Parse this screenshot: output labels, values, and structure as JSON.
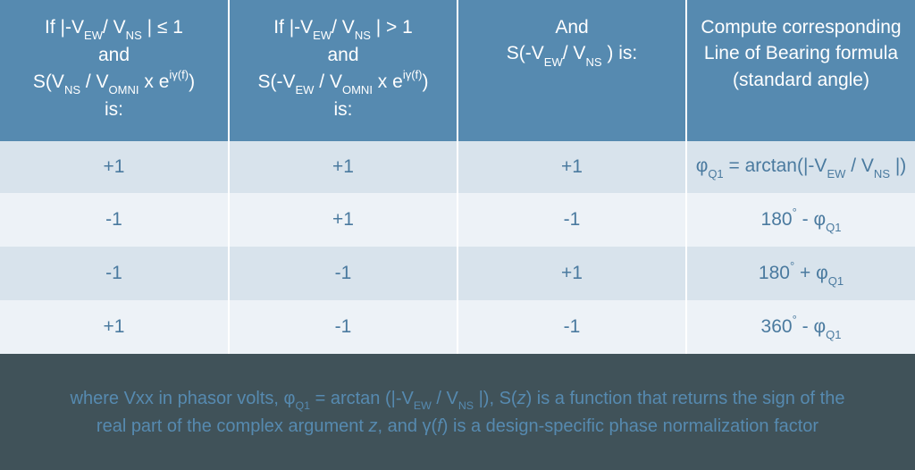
{
  "chart_data": {
    "type": "table",
    "headers": [
      "If |-V_EW / V_NS| ≤ 1 and S(V_NS / V_OMNI × e^{iγ(f)}) is:",
      "If |-V_EW / V_NS| > 1 and S(-V_EW / V_OMNI × e^{iγ(f)}) is:",
      "And S(-V_EW / V_NS) is:",
      "Compute corresponding Line of Bearing formula (standard angle)"
    ],
    "rows": [
      [
        "+1",
        "+1",
        "+1",
        "φ_Q1 = arctan(|-V_EW / V_NS|)"
      ],
      [
        "-1",
        "+1",
        "-1",
        "180° - φ_Q1"
      ],
      [
        "-1",
        "-1",
        "+1",
        "180° + φ_Q1"
      ],
      [
        "+1",
        "-1",
        "-1",
        "360° - φ_Q1"
      ]
    ],
    "footer_note": "where Vxx in phasor volts, φ_Q1 = arctan(|-V_EW / V_NS|), S(z) is a function that returns the sign of the real part of the complex argument z, and γ(f) is a design-specific phase normalization factor"
  },
  "headers": {
    "h1_l1": "If |-V",
    "h1_sub1": "EW",
    "h1_l1b": "/ V",
    "h1_sub2": "NS",
    "h1_l1c": " | ≤ 1",
    "h1_l2": "and",
    "h1_l3a": "S(V",
    "h1_sub3": "NS",
    "h1_l3b": " / V",
    "h1_sub4": "OMNI",
    "h1_l3c": " x e",
    "h1_sup": "iγ(f)",
    "h1_l3d": ")",
    "h1_l4": "is:",
    "h2_l1": "If |-V",
    "h2_sub1": "EW",
    "h2_l1b": "/ V",
    "h2_sub2": "NS",
    "h2_l1c": " | > 1",
    "h2_l2": "and",
    "h2_l3a": "S(-V",
    "h2_sub3": "EW",
    "h2_l3b": " / V",
    "h2_sub4": "OMNI",
    "h2_l3c": " x e",
    "h2_sup": "iγ(f)",
    "h2_l3d": ")",
    "h2_l4": "is:",
    "h3_l1": "And",
    "h3_l2a": "S(-V",
    "h3_sub1": "EW",
    "h3_l2b": "/ V",
    "h3_sub2": "NS",
    "h3_l2c": " )  is:",
    "h4_l1": "Compute corresponding",
    "h4_l2": "Line of Bearing formula",
    "h4_l3": "(standard angle)"
  },
  "rows": [
    {
      "c1": "+1",
      "c2": "+1",
      "c3": "+1",
      "c4a": "φ",
      "c4sub": "Q1",
      "c4b": " = arctan(|-V",
      "c4sub2": "EW",
      "c4c": " / V",
      "c4sub3": "NS",
      "c4d": " |)"
    },
    {
      "c1": "-1",
      "c2": "+1",
      "c3": "-1",
      "c4a": "180",
      "c4deg": "°",
      "c4b": " - φ",
      "c4sub": "Q1"
    },
    {
      "c1": "-1",
      "c2": "-1",
      "c3": "+1",
      "c4a": "180",
      "c4deg": "°",
      "c4b": " + φ",
      "c4sub": "Q1"
    },
    {
      "c1": "+1",
      "c2": "-1",
      "c3": "-1",
      "c4a": "360",
      "c4deg": "°",
      "c4b": " - φ",
      "c4sub": "Q1"
    }
  ],
  "footer": {
    "t1": "where Vxx in phasor volts, φ",
    "sub1": "Q1",
    "t2": " = arctan (|-V",
    "sub2": "EW",
    "t3": " / V",
    "sub3": "NS",
    "t4": " |), S(",
    "z1": "z",
    "t5": ") is a function that returns the sign of the",
    "t6": "real part of the complex argument ",
    "z2": "z",
    "t7": ", and  γ(",
    "f": "f",
    "t8": ") is a design-specific phase normalization factor"
  }
}
